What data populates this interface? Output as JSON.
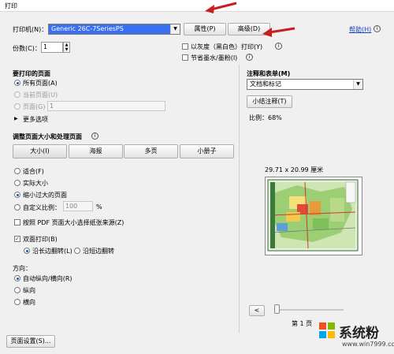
{
  "window": {
    "title": "打印"
  },
  "printer": {
    "label": "打印机(N)：",
    "value": "Generic 26C-7SeriesPS",
    "properties_button": "属性(P)",
    "advanced_button": "高级(D)",
    "help_link": "帮助(H)"
  },
  "copies": {
    "label": "份数(C)：",
    "value": "1"
  },
  "options": {
    "grayscale": "以灰度（黑白色）打印(Y)",
    "save_ink": "节省墨水/墨粉(I)"
  },
  "pages_to_print": {
    "title": "要打印的页面",
    "all_pages": "所有页面(A)",
    "current_page": "当前页面(U)",
    "pages": "页面(G)",
    "pages_value": "1",
    "more_options": "更多选项"
  },
  "page_sizing": {
    "title": "调整页面大小和处理页面",
    "tabs": [
      "大小(I)",
      "海报",
      "多页",
      "小册子"
    ],
    "fit": "适合(F)",
    "actual_size": "实际大小",
    "shrink": "缩小过大的页面",
    "custom_scale": "自定义比例：",
    "custom_value": "100",
    "custom_unit": "%",
    "pdf_paper_source": "按照 PDF 页面大小选择纸张来源(Z)"
  },
  "duplex": {
    "label": "双面打印(B)",
    "long_edge": "沿长边翻转(L)",
    "short_edge": "沿短边翻转"
  },
  "orientation": {
    "title": "方向：",
    "auto": "自动纵向/横向(R)",
    "portrait": "纵向",
    "landscape": "横向"
  },
  "comments": {
    "title": "注释和表单(M)",
    "value": "文档和标记",
    "summarize_button": "小结注释(T)"
  },
  "preview": {
    "scale_text": "比例：68%",
    "page_size_text": "29.71 x 20.99 厘米",
    "page_label": "第 1 页",
    "prev_button": "<"
  },
  "footer": {
    "page_setup_button": "页面设置(S)..."
  },
  "watermark": {
    "text": "系统粉",
    "url": "www.win7999.com"
  },
  "colors": {
    "accent": "#3a6ff0",
    "arrow": "#c81e1e",
    "link": "#1a3fbf"
  }
}
